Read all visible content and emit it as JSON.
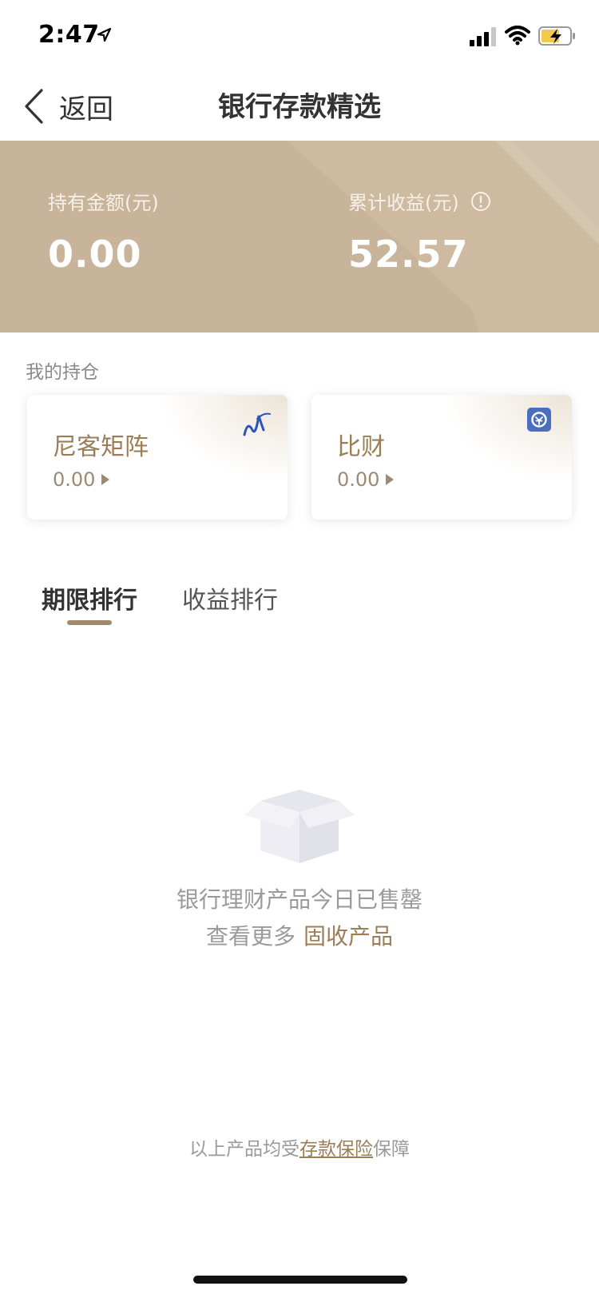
{
  "status_bar": {
    "time": "2:47",
    "icons": [
      "location-arrow-icon",
      "signal-icon",
      "wifi-icon",
      "battery-charging-icon"
    ]
  },
  "nav": {
    "back_label": "返回",
    "title": "银行存款精选"
  },
  "summary": {
    "holding_label": "持有金额(元)",
    "holding_value": "0.00",
    "earnings_label": "累计收益(元)",
    "earnings_value": "52.57",
    "banner_color": "#c8b49a"
  },
  "holdings": {
    "title": "我的持仓",
    "cards": [
      {
        "name": "尼客矩阵",
        "amount": "0.00",
        "logo": "nike-matrix-logo-icon"
      },
      {
        "name": "比财",
        "amount": "0.00",
        "logo": "bicai-logo-icon"
      }
    ]
  },
  "tabs": [
    {
      "label": "期限排行",
      "active": true
    },
    {
      "label": "收益排行",
      "active": false
    }
  ],
  "empty_state": {
    "line1": "银行理财产品今日已售罄",
    "line2_prefix": "查看更多",
    "line2_link": "固收产品"
  },
  "footer": {
    "prefix": "以上产品均受",
    "link": "存款保险",
    "suffix": "保障"
  },
  "colors": {
    "accent_gold": "#9b7e58",
    "tab_indicator": "#a08a6c"
  }
}
